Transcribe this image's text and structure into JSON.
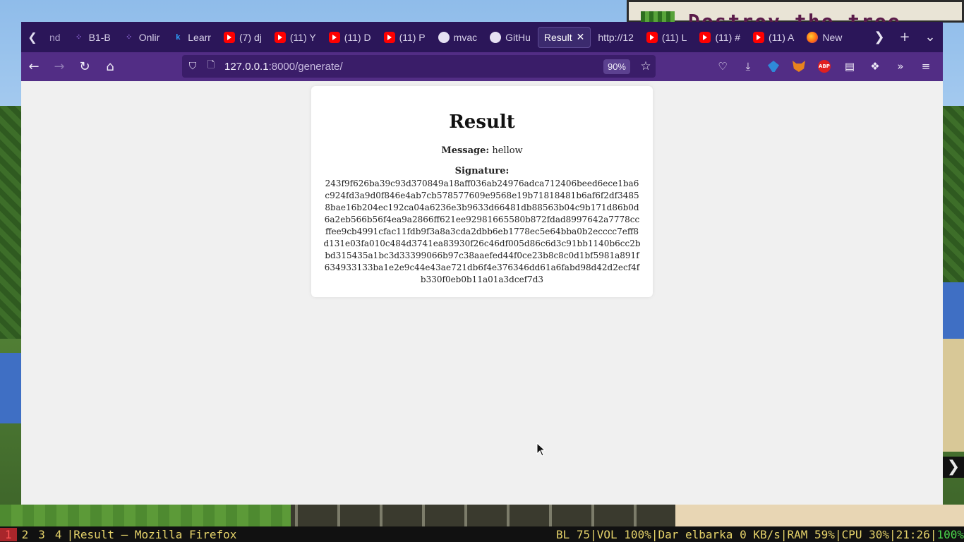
{
  "desktop": {
    "sign_text": "Destroy the tree"
  },
  "browser": {
    "tabs": [
      {
        "label": "nd",
        "icon": "none"
      },
      {
        "label": "B1-B",
        "icon": "dots-icon"
      },
      {
        "label": "Onlir",
        "icon": "dots-icon"
      },
      {
        "label": "Learr",
        "icon": "k-icon"
      },
      {
        "label": "(7) dj",
        "icon": "youtube-icon"
      },
      {
        "label": "(11) Y",
        "icon": "youtube-icon"
      },
      {
        "label": "(11) D",
        "icon": "youtube-icon"
      },
      {
        "label": "(11) P",
        "icon": "youtube-icon"
      },
      {
        "label": "mvac",
        "icon": "github-icon"
      },
      {
        "label": "GitHu",
        "icon": "github-icon"
      },
      {
        "label": "Result",
        "icon": "none",
        "active": true
      },
      {
        "label": "http://12",
        "icon": "none"
      },
      {
        "label": "(11) L",
        "icon": "youtube-icon"
      },
      {
        "label": "(11) #",
        "icon": "youtube-icon"
      },
      {
        "label": "(11) A",
        "icon": "youtube-icon"
      },
      {
        "label": "New",
        "icon": "firefox-icon"
      }
    ],
    "url_host": "127.0.0.1",
    "url_rest": ":8000/generate/",
    "zoom": "90%",
    "colors": {
      "tabbar": "#2b1659",
      "navbar": "#522d85",
      "urlbar": "#3a1d69"
    }
  },
  "page": {
    "title": "Result",
    "message_label": "Message:",
    "message_value": "hellow",
    "signature_label": "Signature:",
    "signature_value": "243f9f626ba39c93d370849a18aff036ab24976adca712406beed6ece1ba6c924fd3a9d0f846e4ab7cb578577609e9568e19b71818481b6af6f2df34858bae16b204ec192ca04a6236e3b9633d66481db88563b04c9b171d86b0d6a2eb566b56f4ea9a2866ff621ee92981665580b872fdad8997642a7778ccffee9cb4991cfac11fdb9f3a8a3cda2dbb6eb1778ec5e64bba0b2ecccc7eff8d131e03fa010c484d3741ea83930f26c46df005d86c6d3c91bb1140b6cc2bbd315435a1bc3d33399066b97c38aaefed44f0ce23b8c8c0d1bf5981a891f634933133ba1e2e9c44e43ae721db6f4e376346dd61a6fabd98d42d2ecf4fb330f0eb0b11a01a3dcef7d3"
  },
  "statusbar": {
    "workspaces": [
      "1",
      "2",
      "3",
      "4"
    ],
    "active_workspace": "1",
    "window_title": "Result — Mozilla Firefox",
    "backlight": "BL 75",
    "volume": "VOL 100%",
    "network": "Dar elbarka 0 KB/s",
    "ram": "RAM 59%",
    "cpu": "CPU 30%",
    "clock": "21:26",
    "battery": "100%"
  }
}
